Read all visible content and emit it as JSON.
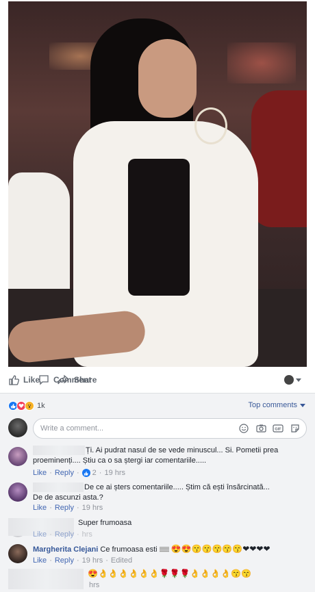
{
  "post": {
    "actions": {
      "like": "Like",
      "comment": "Comment",
      "share": "Share"
    }
  },
  "reactions": {
    "count": "1k",
    "top_comments": "Top comments"
  },
  "composer": {
    "placeholder": "Write a comment..."
  },
  "comments": [
    {
      "text": "Ți. Ai pudrat nasul de se vede minuscul... Si. Pometii prea proeminenți.... Știu ca o sa ștergi iar comentariile.....",
      "like": "Like",
      "reply": "Reply",
      "reaction_count": "2",
      "time": "19 hrs"
    },
    {
      "text": "De ce ai șters comentariile..... Știm că ești însărcinată... De de ascunzi asta.?",
      "like": "Like",
      "reply": "Reply",
      "time": "19 hrs"
    },
    {
      "text": "Super frumoasa",
      "like": "Like",
      "reply": "Reply",
      "time": "hrs"
    },
    {
      "author": "Margherita Clejani",
      "text": "Ce frumoasa esti",
      "emojis": "😍😍😙😙😙😙😙❤❤❤❤",
      "like": "Like",
      "reply": "Reply",
      "time": "19 hrs",
      "edited": "Edited"
    },
    {
      "emojis": "😍👌👌👌👌👌👌🌹🌹🌹👌👌👌👌😙😙",
      "time": "hrs"
    }
  ]
}
